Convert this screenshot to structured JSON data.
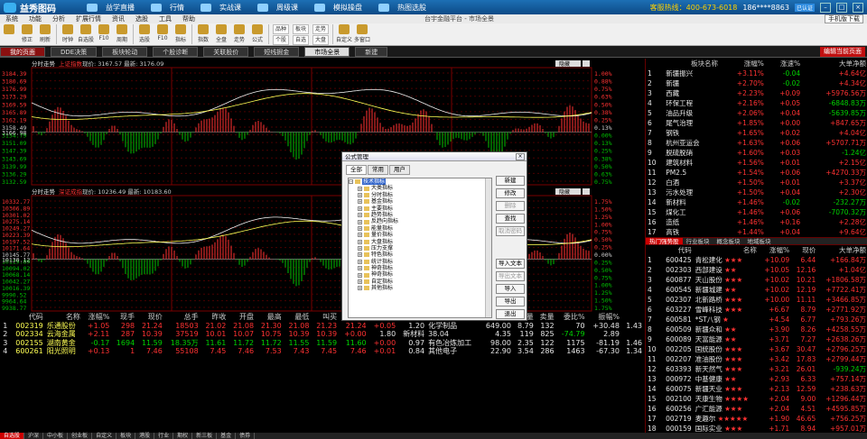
{
  "app": {
    "name": "益秀图码",
    "window_title": "台宇金融平台 - 市场全景"
  },
  "topnav": [
    {
      "label": "益学直播",
      "icon": "play-icon"
    },
    {
      "label": "行情",
      "icon": "chart-icon"
    },
    {
      "label": "实战课",
      "icon": "class-icon"
    },
    {
      "label": "周级课",
      "icon": "course-icon"
    },
    {
      "label": "模拟操盘",
      "icon": "sim-icon"
    },
    {
      "label": "热图选股",
      "icon": "heatmap-icon"
    }
  ],
  "hotline": "客服热线：400-673-6018",
  "user": "186****8863",
  "user_badge": "已认证",
  "menus": [
    "系统",
    "功能",
    "分析",
    "扩展行情",
    "资讯",
    "选股",
    "工具",
    "帮助"
  ],
  "menu_right_button": "手机版下载",
  "toolbar": {
    "tools": [
      "",
      "修正",
      "刷新",
      "时钟",
      "自选股",
      "F10",
      "周期",
      "选股",
      "F10",
      "指标",
      "指数",
      "全盘",
      "走势",
      "公式"
    ],
    "dropdowns": [
      [
        "品种",
        "个股"
      ],
      [
        "板块",
        "自选"
      ],
      [
        "走势",
        "大盘"
      ]
    ],
    "tools2": [
      "自定义",
      "多窗口"
    ]
  },
  "tabs": [
    "我的页面",
    "DDE决策",
    "板块轮动",
    "个股诊断",
    "关联股价",
    "短线掘金",
    "市场全景",
    "新建"
  ],
  "tabs_right": "编辑当前页面",
  "chart_top": {
    "title": "分时走势",
    "subtitle": "上证指数",
    "info": "现价: 3167.57 最新: 3176.09",
    "yticks": [
      "3184.39",
      "3180.69",
      "3176.99",
      "3173.29",
      "3169.59",
      "3165.89",
      "3162.19",
      "3158.49",
      "3154.79",
      "3151.09",
      "3147.39",
      "3143.69",
      "3139.99",
      "3136.29",
      "3132.59"
    ],
    "pct": [
      "1.00%",
      "0.88%",
      "0.75%",
      "0.63%",
      "0.50%",
      "0.38%",
      "0.25%",
      "0.13%",
      "0.00%",
      "0.13%",
      "0.25%",
      "0.38%",
      "0.50%",
      "0.63%",
      "0.75%"
    ],
    "prev": "3166.98",
    "btn": "隐藏"
  },
  "chart_bot": {
    "title": "分时走势",
    "subtitle": "深证成指",
    "info": "现价: 10236.49 最新: 10183.60",
    "yticks": [
      "10332.77",
      "10306.89",
      "10301.02",
      "10275.14",
      "10249.27",
      "10223.39",
      "10197.52",
      "10171.64",
      "10145.77",
      "10119.89",
      "10094.02",
      "10068.14",
      "10042.27",
      "10016.39",
      "9990.52",
      "9964.64",
      "9938.77"
    ],
    "pct": [
      "1.75%",
      "1.50%",
      "1.25%",
      "1.00%",
      "0.75%",
      "0.50%",
      "0.25%",
      "0.00%",
      "0.25%",
      "0.50%",
      "0.75%",
      "1.00%",
      "1.25%",
      "1.50%",
      "1.75%"
    ],
    "prev": "10130.12",
    "btn": "隐藏"
  },
  "grid": {
    "headers": [
      "",
      "代码",
      "名称",
      "涨幅%",
      "现手",
      "现价",
      "总手",
      "昨收",
      "开盘",
      "最高",
      "最低",
      "叫买",
      "叫卖",
      "涨跌",
      "量比",
      "所属行业",
      "市盈率",
      "买量",
      "卖量",
      "委比%",
      "振幅%"
    ],
    "rows": [
      [
        "1",
        "002319",
        "乐通股份",
        "+1.05",
        "298",
        "21.24",
        "18503",
        "21.02",
        "21.08",
        "21.30",
        "21.08",
        "21.23",
        "21.24",
        "+0.05",
        "1.20",
        "化学制品",
        "649.00",
        "8.79",
        "132",
        "70",
        "+30.48",
        "1.43"
      ],
      [
        "2",
        "002334",
        "云海金属",
        "+2.11",
        "287",
        "10.39",
        "37519",
        "10.01",
        "10.07",
        "10.75",
        "10.39",
        "10.39",
        "+0.00",
        "1.80",
        "新材料",
        "38.04",
        "4.35",
        "119",
        "825",
        "-74.79",
        "2.89"
      ],
      [
        "3",
        "002155",
        "湖南黄金",
        "-0.17",
        "1694",
        "11.59",
        "18.35万",
        "11.61",
        "11.72",
        "11.72",
        "11.55",
        "11.59",
        "11.60",
        "+0.00",
        "0.97",
        "有色冶炼加工",
        "98.00",
        "2.35",
        "122",
        "1175",
        "-81.19",
        "1.46"
      ],
      [
        "4",
        "600261",
        "阳光照明",
        "+0.13",
        "1",
        "7.46",
        "55108",
        "7.45",
        "7.46",
        "7.53",
        "7.43",
        "7.45",
        "7.46",
        "+0.01",
        "0.84",
        "其他电子",
        "22.90",
        "3.54",
        "286",
        "1463",
        "-67.30",
        "1.34"
      ]
    ]
  },
  "sectors": {
    "headers": [
      "",
      "板块名称",
      "涨幅%",
      "涨速%",
      "大单净额"
    ],
    "rows": [
      [
        "1",
        "新疆振兴",
        "+3.11%",
        "-0.04",
        "+4.64亿"
      ],
      [
        "2",
        "新疆",
        "+2.70%",
        "-0.02",
        "+4.34亿"
      ],
      [
        "3",
        "西藏",
        "+2.23%",
        "+0.09",
        "+5976.56万"
      ],
      [
        "4",
        "环保工程",
        "+2.16%",
        "+0.05",
        "-6848.83万"
      ],
      [
        "5",
        "油品升级",
        "+2.06%",
        "+0.04",
        "-5639.85万"
      ],
      [
        "6",
        "尾气治理",
        "+1.85%",
        "+0.00",
        "+847.65万"
      ],
      [
        "7",
        "钢铁",
        "+1.65%",
        "+0.02",
        "+4.04亿"
      ],
      [
        "8",
        "杭州亚运会",
        "+1.63%",
        "+0.06",
        "+5707.71万"
      ],
      [
        "9",
        "脱硫脱硝",
        "+1.60%",
        "+0.03",
        "-1.24亿"
      ],
      [
        "10",
        "建筑材料",
        "+1.56%",
        "+0.01",
        "+2.15亿"
      ],
      [
        "11",
        "PM2.5",
        "+1.54%",
        "+0.06",
        "+4270.33万"
      ],
      [
        "12",
        "白酒",
        "+1.50%",
        "+0.01",
        "+3.37亿"
      ],
      [
        "13",
        "污水处理",
        "+1.50%",
        "+0.04",
        "+2.30亿"
      ],
      [
        "14",
        "新材料",
        "+1.46%",
        "-0.02",
        "-232.27万"
      ],
      [
        "15",
        "煤化工",
        "+1.46%",
        "+0.06",
        "-7070.32万"
      ],
      [
        "16",
        "造纸",
        "+1.46%",
        "+0.16",
        "+2.28亿"
      ],
      [
        "17",
        "高铁",
        "+1.44%",
        "+0.04",
        "+9.64亿"
      ]
    ]
  },
  "rtabs": [
    "热门强势股",
    "行业板块",
    "概念板块",
    "地域板块"
  ],
  "stocks": {
    "headers": [
      "",
      "代码",
      "名称",
      "涨幅%",
      "现价",
      "大单净额"
    ],
    "rows": [
      [
        "1",
        "600425",
        "青松建化",
        3,
        "+10.09",
        "6.44",
        "+166.84万"
      ],
      [
        "2",
        "002303",
        "西部建设",
        2,
        "+10.05",
        "12.16",
        "+1.04亿"
      ],
      [
        "3",
        "600877",
        "天山股份",
        3,
        "+10.02",
        "10.21",
        "+1806.58万"
      ],
      [
        "4",
        "600545",
        "新疆城建",
        2,
        "+10.02",
        "12.19",
        "+7722.41万"
      ],
      [
        "5",
        "002307",
        "北新路桥",
        3,
        "+10.00",
        "11.11",
        "+3466.85万"
      ],
      [
        "6",
        "603227",
        "雪峰科技",
        3,
        "+6.67",
        "8.79",
        "+2771.92万"
      ],
      [
        "7",
        "600581",
        "*ST八钢",
        1,
        "+4.54",
        "6.77",
        "+793.26万"
      ],
      [
        "8",
        "600509",
        "新疆众和",
        2,
        "+3.90",
        "8.26",
        "+4258.55万"
      ],
      [
        "9",
        "600089",
        "天富能源",
        2,
        "+3.71",
        "7.27",
        "+2638.26万"
      ],
      [
        "10",
        "002205",
        "国统股份",
        3,
        "+3.67",
        "30.47",
        "+2796.25万"
      ],
      [
        "11",
        "002207",
        "准油股份",
        3,
        "+3.42",
        "17.83",
        "+2799.44万"
      ],
      [
        "12",
        "603393",
        "新天然气",
        3,
        "+3.21",
        "26.01",
        "-939.24万"
      ],
      [
        "13",
        "000972",
        "中基健康",
        2,
        "+2.93",
        "6.33",
        "+757.14万"
      ],
      [
        "14",
        "600075",
        "新疆天业",
        3,
        "+2.13",
        "12.59",
        "+238.63万"
      ],
      [
        "15",
        "002100",
        "天康生物",
        4,
        "+2.04",
        "9.00",
        "+1296.44万"
      ],
      [
        "16",
        "600256",
        "广汇能源",
        3,
        "+2.04",
        "4.51",
        "+4595.85万"
      ],
      [
        "17",
        "002719",
        "麦趣尔",
        5,
        "+1.90",
        "46.65",
        "+756.25万"
      ],
      [
        "18",
        "000159",
        "国际实业",
        3,
        "+1.71",
        "8.94",
        "+957.01万"
      ]
    ]
  },
  "statusbar": [
    "自选股",
    "沪深",
    "中小板",
    "创业板",
    "自定义",
    "板块",
    "港股",
    "行业",
    "期权",
    "新三板",
    "基金",
    "债券"
  ],
  "dialog": {
    "title": "公式管理",
    "tabs": [
      "全部",
      "常用",
      "用户"
    ],
    "root": "技术指标",
    "nodes": [
      "大类指标",
      "分时指标",
      "基金指标",
      "主要指标",
      "趋势指标",
      "反趋向指标",
      "能量指标",
      "量价指标",
      "大盘指标",
      "压力支撑",
      "特色指标",
      "统计指标",
      "神奇指标",
      "神奇指标",
      "自定指标",
      "其他指标"
    ],
    "buttons": [
      {
        "label": "新建",
        "enabled": true
      },
      {
        "label": "修改",
        "enabled": true
      },
      {
        "label": "删除",
        "enabled": false
      },
      {
        "label": "查找",
        "enabled": true
      },
      {
        "label": "取消密码",
        "enabled": false
      },
      {
        "label": "导入文本",
        "enabled": true
      },
      {
        "label": "导出文本",
        "enabled": false
      },
      {
        "label": "导入",
        "enabled": true
      },
      {
        "label": "导出",
        "enabled": true
      },
      {
        "label": "退出",
        "enabled": true
      }
    ]
  },
  "colors": {
    "up": "#ff3232",
    "down": "#00d000",
    "price": "#ffff54",
    "grid": "#7a0000"
  }
}
